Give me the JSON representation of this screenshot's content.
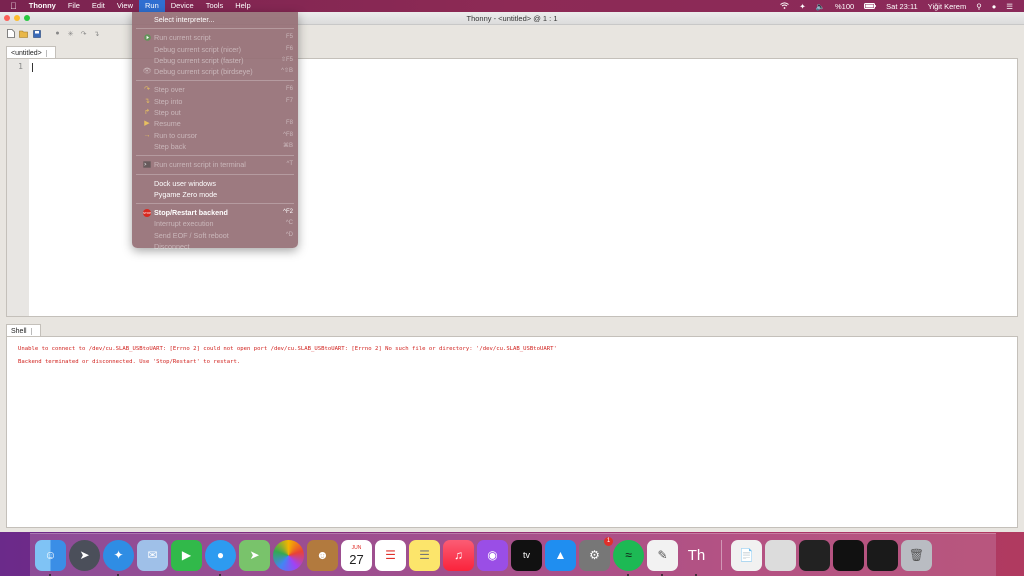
{
  "menubar": {
    "apple_icon": "apple-logo",
    "app_name": "Thonny",
    "menus": [
      "File",
      "Edit",
      "View",
      "Run",
      "Device",
      "Tools",
      "Help"
    ],
    "active_menu": "Run",
    "status": {
      "battery": "%100",
      "clock": "Sat 23:11",
      "user": "Yiğit Kerem"
    }
  },
  "window": {
    "title": "Thonny  -  <untitled>  @  1 : 1"
  },
  "editor": {
    "tab_label": "<untitled>",
    "line_number": "1"
  },
  "shell": {
    "tab_label": "Shell",
    "lines": [
      "Unable to connect to /dev/cu.SLAB_USBtoUART: [Errno 2] could not open port /dev/cu.SLAB_USBtoUART: [Errno 2] No such file or directory: '/dev/cu.SLAB_USBtoUART'",
      "Backend terminated or disconnected. Use 'Stop/Restart' to restart."
    ]
  },
  "run_menu": {
    "select_interpreter": "Select interpreter...",
    "run_current_script": {
      "label": "Run current script",
      "shortcut": "F5"
    },
    "debug_nicer": {
      "label": "Debug current script (nicer)",
      "shortcut": "F6"
    },
    "debug_faster": {
      "label": "Debug current script (faster)",
      "shortcut": "⇧F5"
    },
    "debug_birdseye": {
      "label": "Debug current script (birdseye)",
      "shortcut": "^⇧B"
    },
    "step_over": {
      "label": "Step over",
      "shortcut": "F6"
    },
    "step_into": {
      "label": "Step into",
      "shortcut": "F7"
    },
    "step_out": {
      "label": "Step out",
      "shortcut": ""
    },
    "resume": {
      "label": "Resume",
      "shortcut": "F8"
    },
    "run_to_cursor": {
      "label": "Run to cursor",
      "shortcut": "^F8"
    },
    "step_back": {
      "label": "Step back",
      "shortcut": "⌘B"
    },
    "run_in_terminal": {
      "label": "Run current script in terminal",
      "shortcut": "^T"
    },
    "dock_user_windows": "Dock user windows",
    "pygame_zero_mode": "Pygame Zero mode",
    "stop_restart": {
      "label": "Stop/Restart backend",
      "shortcut": "^F2"
    },
    "interrupt": {
      "label": "Interrupt execution",
      "shortcut": "^C"
    },
    "send_eof": {
      "label": "Send EOF / Soft reboot",
      "shortcut": "^D"
    },
    "disconnect": {
      "label": "Disconnect",
      "shortcut": ""
    }
  },
  "dock": {
    "calendar_month": "JUN",
    "calendar_day": "27",
    "system_prefs_badge": "1",
    "apple_tv_label": "tv",
    "thonny_label": "Th"
  },
  "colors": {
    "error_text": "#d0201c",
    "menu_active": "#2f6fd1"
  }
}
